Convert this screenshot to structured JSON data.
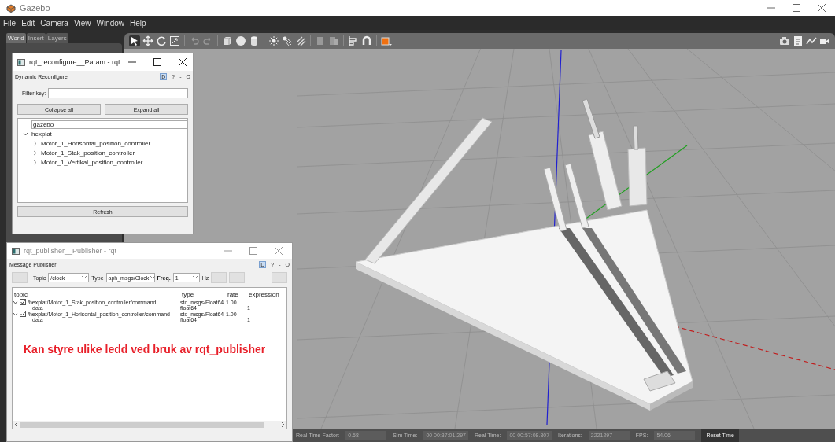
{
  "window": {
    "title": "Gazebo"
  },
  "menu": [
    "File",
    "Edit",
    "Camera",
    "View",
    "Window",
    "Help"
  ],
  "left_panel": {
    "tabs": [
      {
        "label": "World",
        "selected": true
      },
      {
        "label": "Insert",
        "selected": false
      },
      {
        "label": "Layers",
        "selected": false
      }
    ]
  },
  "reconfigure_window": {
    "title": "rqt_reconfigure__Param - rqt",
    "active": true,
    "plugin_title": "Dynamic Reconfigure",
    "plugin_controls": [
      "D",
      "?",
      "-",
      "O"
    ],
    "filter_label": "Filter key:",
    "buttons": [
      "Collapse all",
      "Expand all"
    ],
    "tree": [
      {
        "label": "gazebo",
        "selected": true,
        "expandable": false,
        "expanded": false
      },
      {
        "label": "hexplat",
        "selected": false,
        "expandable": true,
        "expanded": true,
        "children": [
          {
            "label": "Motor_1_Horisontal_position_controller",
            "selected": false,
            "expandable": true,
            "expanded": false
          },
          {
            "label": "Motor_1_Stak_position_controller",
            "selected": false,
            "expandable": true,
            "expanded": false
          },
          {
            "label": "Motor_1_Vertikal_position_controller",
            "selected": false,
            "expandable": true,
            "expanded": false
          }
        ]
      }
    ],
    "refresh": "Refresh"
  },
  "publisher_window": {
    "title": "rqt_publisher__Publisher - rqt",
    "active": false,
    "plugin_title": "Message Publisher",
    "plugin_controls": [
      "D",
      "?",
      "-",
      "O"
    ],
    "topic_label": "Topic",
    "topic": "/clock",
    "type_label": "Type",
    "type": "aph_msgs/Clock",
    "freq_label": "Freq.",
    "freq": "1",
    "freq_unit": "Hz",
    "columns": [
      "topic",
      "type",
      "rate",
      "expression"
    ],
    "rows": [
      {
        "topic": "/hexplat/Motor_1_Stak_position_controller/command",
        "type": "std_msgs/Float64",
        "rate": "1.00",
        "checked": true,
        "expanded": true,
        "children": [
          {
            "topic": "data",
            "type": "float64",
            "expression": "1"
          }
        ]
      },
      {
        "topic": "/hexplat/Motor_1_Horisontal_position_controller/command",
        "type": "std_msgs/Float64",
        "rate": "1.00",
        "checked": true,
        "expanded": true,
        "children": [
          {
            "topic": "data",
            "type": "float64",
            "expression": "1"
          }
        ]
      }
    ],
    "annotation": "Kan styre ulike ledd ved bruk av rqt_publisher"
  },
  "status_bar": {
    "fields": [
      {
        "label": "Real Time Factor:",
        "value": "0.58"
      },
      {
        "label": "Sim Time:",
        "value": "00 00:37:01.297"
      },
      {
        "label": "Real Time:",
        "value": "00 00:57:08.807"
      },
      {
        "label": "Iterations:",
        "value": "2221297"
      },
      {
        "label": "FPS:",
        "value": "54.06"
      }
    ],
    "button": "Reset Time"
  }
}
